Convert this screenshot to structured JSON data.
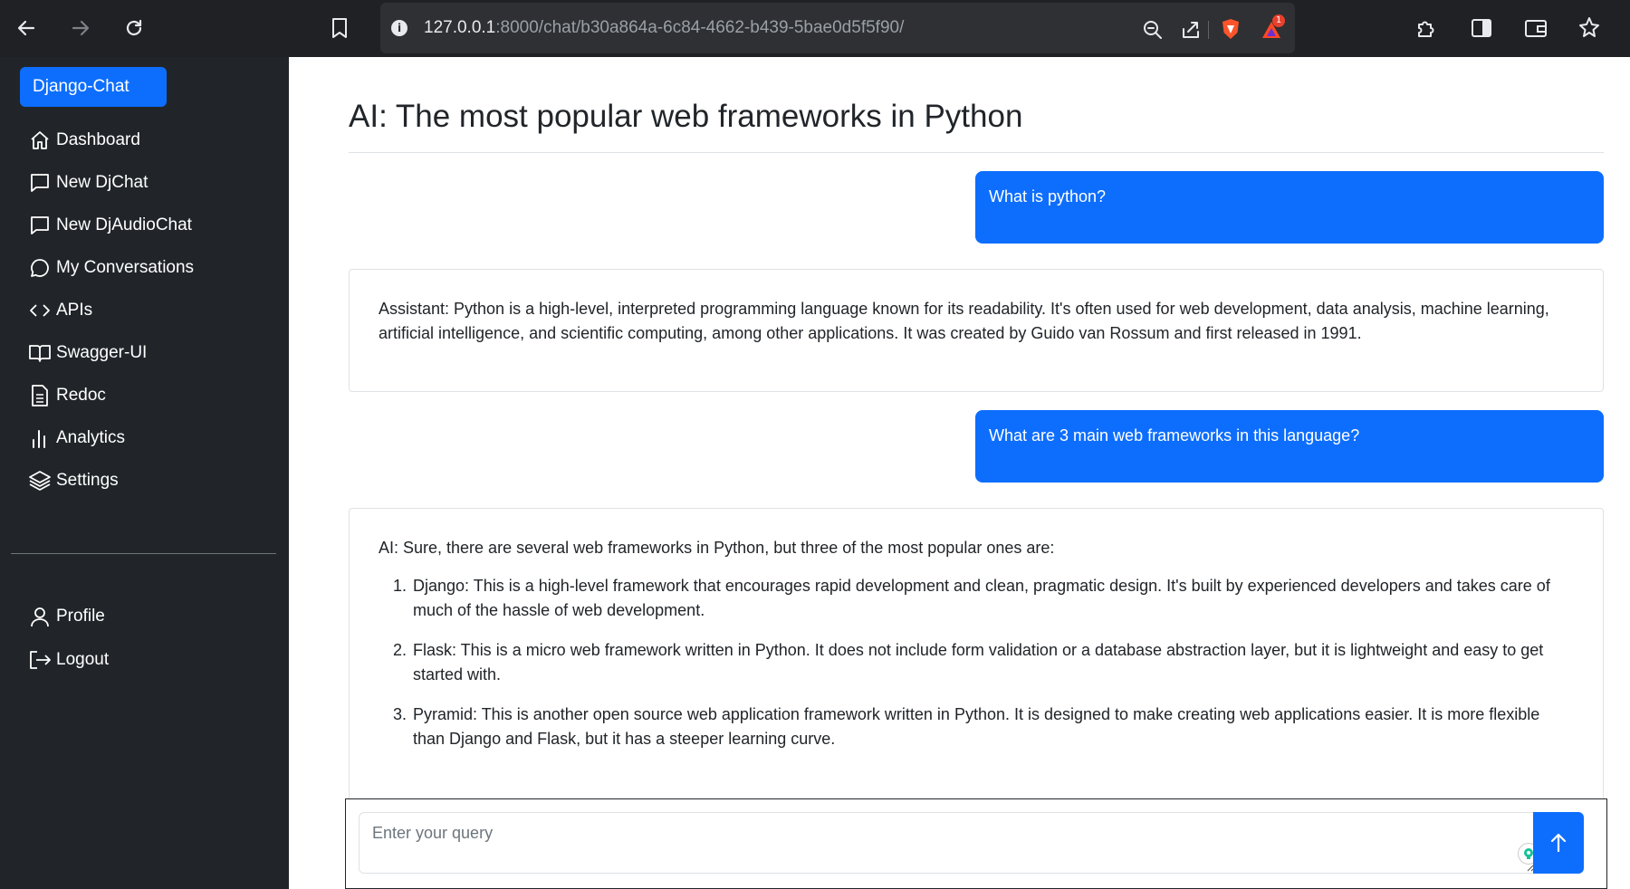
{
  "browser": {
    "url_host": "127.0.0.1",
    "url_rest": ":8000/chat/b30a864a-6c84-4662-b439-5bae0d5f5f90/",
    "notification_count": "1"
  },
  "sidebar": {
    "brand": "Django-Chat",
    "items": [
      {
        "label": "Dashboard",
        "icon": "house-icon"
      },
      {
        "label": "New DjChat",
        "icon": "chat-square-icon"
      },
      {
        "label": "New DjAudioChat",
        "icon": "chat-square-icon"
      },
      {
        "label": "My Conversations",
        "icon": "chat-bubble-icon"
      },
      {
        "label": "APIs",
        "icon": "code-icon"
      },
      {
        "label": "Swagger-UI",
        "icon": "book-icon"
      },
      {
        "label": "Redoc",
        "icon": "document-icon"
      },
      {
        "label": "Analytics",
        "icon": "bar-chart-icon"
      },
      {
        "label": "Settings",
        "icon": "layers-icon"
      }
    ],
    "account": [
      {
        "label": "Profile",
        "icon": "person-icon"
      },
      {
        "label": "Logout",
        "icon": "logout-icon"
      }
    ]
  },
  "main": {
    "title": "AI: The most popular web frameworks in Python",
    "messages": [
      {
        "role": "user",
        "text": "What is python?"
      },
      {
        "role": "assistant",
        "text": "Assistant: Python is a high-level, interpreted programming language known for its readability. It's often used for web development, data analysis, machine learning, artificial intelligence, and scientific computing, among other applications. It was created by Guido van Rossum and first released in 1991."
      },
      {
        "role": "user",
        "text": "What are 3 main web frameworks in this language?"
      },
      {
        "role": "assistant",
        "intro": "AI: Sure, there are several web frameworks in Python, but three of the most popular ones are:",
        "list": [
          "Django: This is a high-level framework that encourages rapid development and clean, pragmatic design. It's built by experienced developers and takes care of much of the hassle of web development.",
          "Flask: This is a micro web framework written in Python. It does not include form validation or a database abstraction layer, but it is lightweight and easy to get started with.",
          "Pyramid: This is another open source web application framework written in Python. It is designed to make creating web applications easier. It is more flexible than Django and Flask, but it has a steeper learning curve."
        ]
      }
    ],
    "query": {
      "placeholder": "Enter your query",
      "value": ""
    },
    "ext_letter": "G"
  },
  "colors": {
    "sidebar_bg": "#212529",
    "accent": "#0d6efd",
    "chrome_bg": "#202124"
  }
}
